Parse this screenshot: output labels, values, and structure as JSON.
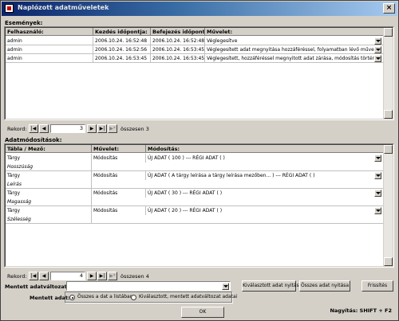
{
  "window": {
    "title": "Naplózott adatműveletek"
  },
  "events": {
    "section_label": "Események:",
    "columns": [
      "Felhasználó:",
      "Kezdés időpontja:",
      "Befejezés időpontja:",
      "Művelet:"
    ],
    "rows": [
      {
        "user": "admin",
        "start": "2006.10.24. 16:52:48",
        "end": "2006.10.24. 16:52:48",
        "action": "Véglegesítve"
      },
      {
        "user": "admin",
        "start": "2006.10.24. 16:52:56",
        "end": "2006.10.24. 16:53:45",
        "action": "Véglegesített adat megnyitása hozzáféréssel, folyamatban lévő művelet"
      },
      {
        "user": "admin",
        "start": "2006.10.24. 16:53:45",
        "end": "2006.10.24. 16:53:45",
        "action": "Véglegesített, hozzáféréssel megnyitott adat zárása, módosítás történt"
      }
    ],
    "nav": {
      "label": "Rekord:",
      "current": "3",
      "total": "összesen 3"
    }
  },
  "changes": {
    "section_label": "Adatmódosítások:",
    "columns": [
      "Tábla / Mező:",
      "Művelet:",
      "Módosítás:"
    ],
    "rows": [
      {
        "table": "Tárgy",
        "field": "Hosszúság",
        "op": "Módosítás",
        "change": "ÚJ ADAT ( 100 )  ---  RÉGI ADAT ( )"
      },
      {
        "table": "Tárgy",
        "field": "Leírás",
        "op": "Módosítás",
        "change": "ÚJ ADAT ( A tárgy leírása a tárgy leírása mezőben... )  ---  RÉGI ADAT ( )"
      },
      {
        "table": "Tárgy",
        "field": "Magasság",
        "op": "Módosítás",
        "change": "ÚJ ADAT ( 30 )  ---  RÉGI ADAT ( )"
      },
      {
        "table": "Tárgy",
        "field": "Szélesség",
        "op": "Módosítás",
        "change": "ÚJ ADAT ( 20 )  ---  RÉGI ADAT ( )"
      }
    ],
    "nav": {
      "label": "Rekord:",
      "current": "4",
      "total": "összesen 4"
    }
  },
  "bottom": {
    "saved_label": "Mentett adatváltozatok:",
    "saved_value": "",
    "btn_open_selected": "Kiválasztott adat nyitása",
    "btn_open_all": "Összes adat nyitása",
    "btn_refresh": "Frissítés",
    "saved_data_label": "Mentett adat:",
    "radio_all": "Összes a dat a listában",
    "radio_selected": "Kiválasztott, mentett adatváltozat adatai",
    "ok": "OK",
    "zoom": "Nagyítás: SHIFT + F2"
  },
  "colors": {
    "titlebar_start": "#0a246a",
    "titlebar_end": "#a6caf0",
    "combo_bg": "#ffffff"
  }
}
